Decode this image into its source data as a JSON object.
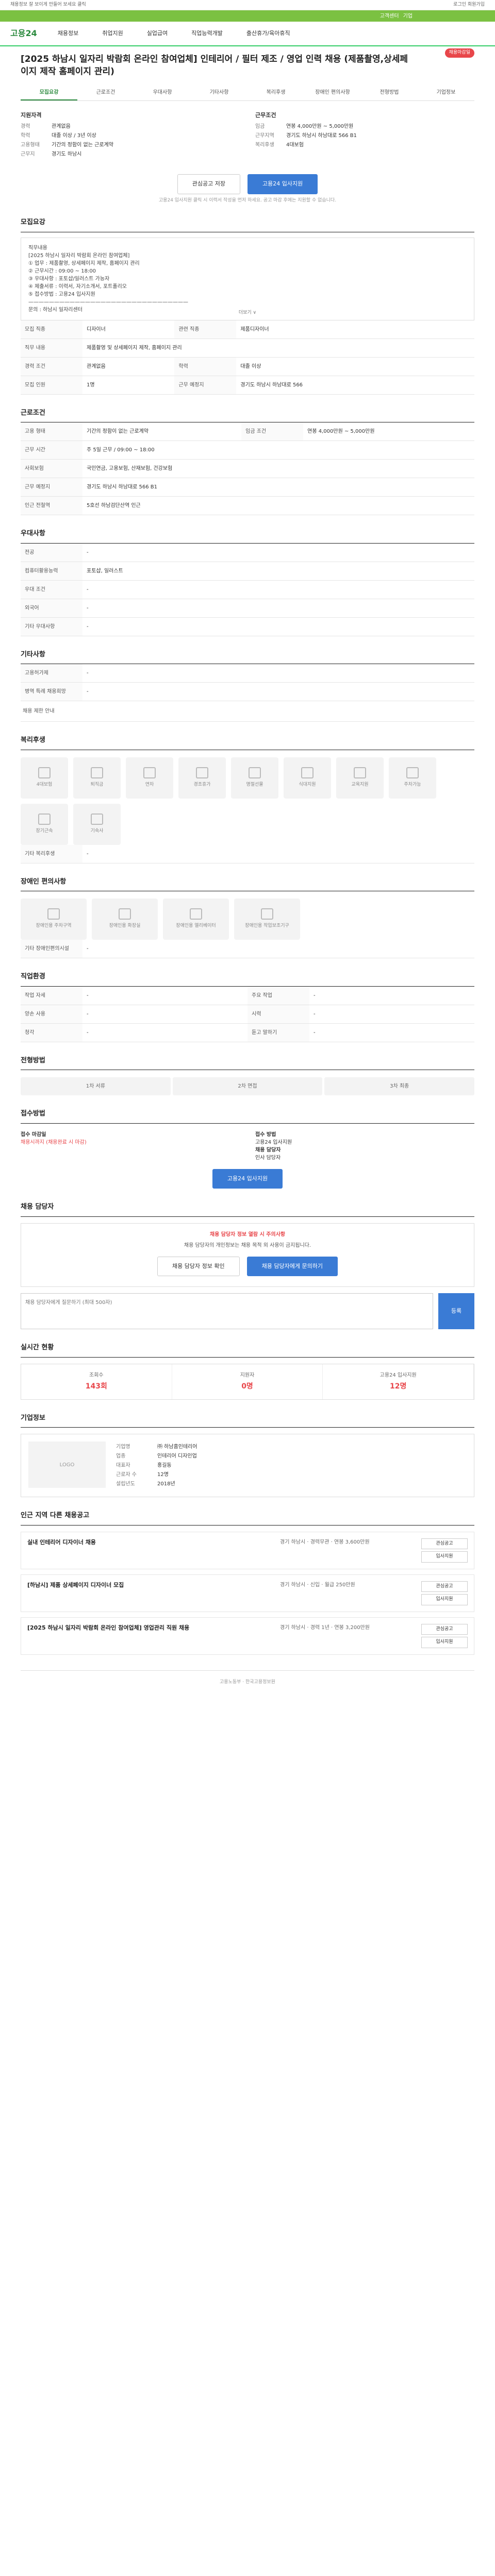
{
  "topbar": {
    "left": "채용정보 잘 보이게 만들어 보세요 클릭",
    "right": "로그인 회원가입"
  },
  "greenbar": {
    "links": [
      "고객센터",
      "기업"
    ]
  },
  "header": {
    "logo": "고용24",
    "nav": [
      "채용정보",
      "취업지원",
      "실업급여",
      "직업능력개발",
      "출산휴가/육아휴직"
    ]
  },
  "job": {
    "title": "[2025 하남시 일자리 박람회 온라인 참여업체] 인테리어 / 필터 제조 / 영업 인력 채용 (제품촬영,상세페이지 제작 홈페이지 관리)",
    "badge": "채용마감일",
    "tabs": [
      "모집요강",
      "근로조건",
      "우대사항",
      "기타사항",
      "복리후생",
      "장애인 편의사항",
      "전형방법",
      "기업정보"
    ]
  },
  "summary": {
    "left_title": "지원자격",
    "left": [
      {
        "k": "경력",
        "v": "관계없음"
      },
      {
        "k": "학력",
        "v": "대졸 이상 / 3년 이상"
      },
      {
        "k": "고용형태",
        "v": "기간의 정함이 없는 근로계약"
      },
      {
        "k": "근무지",
        "v": "경기도 하남시"
      }
    ],
    "right_title": "근무조건",
    "right": [
      {
        "k": "임금",
        "v": "연봉 4,000만원 ~ 5,000만원"
      },
      {
        "k": "근무지역",
        "v": "경기도 하남시 하남대로 566 B1"
      },
      {
        "k": "복리후생",
        "v": "4대보험"
      }
    ]
  },
  "buttons": {
    "scrap": "관심공고 저장",
    "apply": "고용24 입사지원"
  },
  "apply_note": "고용24 입사지원 클릭 시 이력서 작성을 먼저 하세요. 공고 마감 후에는 지원할 수 없습니다.",
  "sections": {
    "recruit": {
      "title": "모집요강",
      "text": "직무내용\n[2025 하남시 일자리 박람회 온라인 참여업체]\n① 업무 : 제품촬영, 상세페이지 제작, 홈페이지 관리\n② 근무시간 : 09:00 ~ 18:00\n③ 우대사항 : 포토샵/일러스트 가능자\n④ 제출서류 : 이력서, 자기소개서, 포트폴리오\n⑤ 접수방법 : 고용24 입사지원\n———————————————————————————————\n문의 : 하남시 일자리센터",
      "more": "더보기 ∨"
    },
    "table1": [
      {
        "k": "모집 직종",
        "v": "디자이너"
      },
      {
        "k": "관련 직종",
        "v": "제품디자이너"
      },
      {
        "k": "직무 내용",
        "v": "제품촬영 및 상세페이지 제작, 홈페이지 관리"
      },
      {
        "k": "경력 조건",
        "v": "관계없음"
      },
      {
        "k": "학력",
        "v": "대졸 이상"
      },
      {
        "k": "모집 인원",
        "v": "1명"
      },
      {
        "k": "근무 예정지",
        "v": "경기도 하남시 하남대로 566"
      }
    ],
    "cond": {
      "title": "근로조건",
      "rows": [
        {
          "k": "고용 형태",
          "v": "기간의 정함이 없는 근로계약"
        },
        {
          "k": "임금 조건",
          "v": "연봉 4,000만원 ~ 5,000만원"
        },
        {
          "k": "근무 시간",
          "v": "주 5일 근무 / 09:00 ~ 18:00"
        },
        {
          "k": "사회보험",
          "v": "국민연금, 고용보험, 산재보험, 건강보험"
        },
        {
          "k": "근무 예정지",
          "v": "경기도 하남시 하남대로 566 B1"
        },
        {
          "k": "인근 전철역",
          "v": "5호선 하남검단산역 인근"
        }
      ]
    },
    "pref": {
      "title": "우대사항",
      "rows": [
        {
          "k": "전공",
          "v": "-"
        },
        {
          "k": "컴퓨터활용능력",
          "v": "포토샵, 일러스트"
        },
        {
          "k": "우대 조건",
          "v": "-"
        },
        {
          "k": "외국어",
          "v": "-"
        },
        {
          "k": "기타 우대사항",
          "v": "-"
        }
      ]
    },
    "etc": {
      "title": "기타사항",
      "rows": [
        {
          "k": "고용허가제",
          "v": "-"
        },
        {
          "k": "병역 특례 채용희망",
          "v": "-"
        }
      ],
      "link": "채용 제한 안내"
    },
    "welfare": {
      "title": "복리후생",
      "items": [
        "4대보험",
        "퇴직금",
        "연차",
        "경조휴가",
        "명절선물",
        "식대지원",
        "교육지원",
        "주차가능",
        "장기근속",
        "기숙사"
      ],
      "other_label": "기타 복리후생",
      "other": "-"
    },
    "disabled": {
      "title": "장애인 편의사항",
      "items": [
        "장애인용 주차구역",
        "장애인용 화장실",
        "장애인용 엘리베이터",
        "장애인용 작업보조기구"
      ],
      "other_label": "기타 장애인편의시설",
      "other": "-"
    },
    "worktime": {
      "title": "직업환경",
      "rows": [
        {
          "k": "작업 자세",
          "v": "-"
        },
        {
          "k": "주요 작업",
          "v": "-"
        },
        {
          "k": "양손 사용",
          "v": "-"
        },
        {
          "k": "시력",
          "v": "-"
        },
        {
          "k": "청각",
          "v": "-"
        },
        {
          "k": "듣고 말하기",
          "v": "-"
        }
      ]
    },
    "process": {
      "title": "전형방법",
      "steps": [
        "1차 서류",
        "2차 면접",
        "3차 최종"
      ]
    },
    "contact": {
      "title": "접수방법",
      "left_label": "접수 마감일",
      "left": "채용시까지 (채용완료 시 마감)",
      "right_label": "접수 방법",
      "right": "고용24 입사지원",
      "manager_label": "채용 담당자",
      "manager": "인사 담당자"
    },
    "apply_btn": "고용24 입사지원",
    "qa": {
      "title": "채용 담당자",
      "warn": "채용 담당자 정보 열람 시 주의사항",
      "warn_text": "채용 담당자의 개인정보는 채용 목적 외 사용이 금지됩니다.",
      "btn1": "채용 담당자 정보 확인",
      "btn2": "채용 담당자에게 문의하기",
      "placeholder": "채용 담당자에게 질문하기 (최대 500자)",
      "submit": "등록"
    },
    "stats": {
      "title": "실시간 현황",
      "items": [
        {
          "l": "조회수",
          "v": "143회"
        },
        {
          "l": "지원자",
          "v": "0명"
        },
        {
          "l": "고용24 입사지원",
          "v": "12명"
        }
      ]
    },
    "company": {
      "title": "기업정보",
      "logo": "LOGO",
      "rows": [
        {
          "k": "기업명",
          "v": "㈜ 하남홈인테리어"
        },
        {
          "k": "업종",
          "v": "인테리어 디자인업"
        },
        {
          "k": "대표자",
          "v": "홍길동"
        },
        {
          "k": "근로자 수",
          "v": "12명"
        },
        {
          "k": "설립년도",
          "v": "2018년"
        }
      ]
    },
    "similar": {
      "title": "인근 지역 다른 채용공고",
      "items": [
        {
          "t": "실내 인테리어 디자이너 채용",
          "m": "경기 하남시 · 경력무관 · 연봉 3,600만원"
        },
        {
          "t": "[하남시] 제품 상세페이지 디자이너 모집",
          "m": "경기 하남시 · 신입 · 월급 250만원"
        },
        {
          "t": "[2025 하남시 일자리 박람회 온라인 참여업체] 영업관리 직원 채용",
          "m": "경기 하남시 · 경력 1년 · 연봉 3,200만원"
        }
      ],
      "actions": [
        "관심공고",
        "입사지원"
      ]
    },
    "footer": "고용노동부 · 한국고용정보원"
  }
}
